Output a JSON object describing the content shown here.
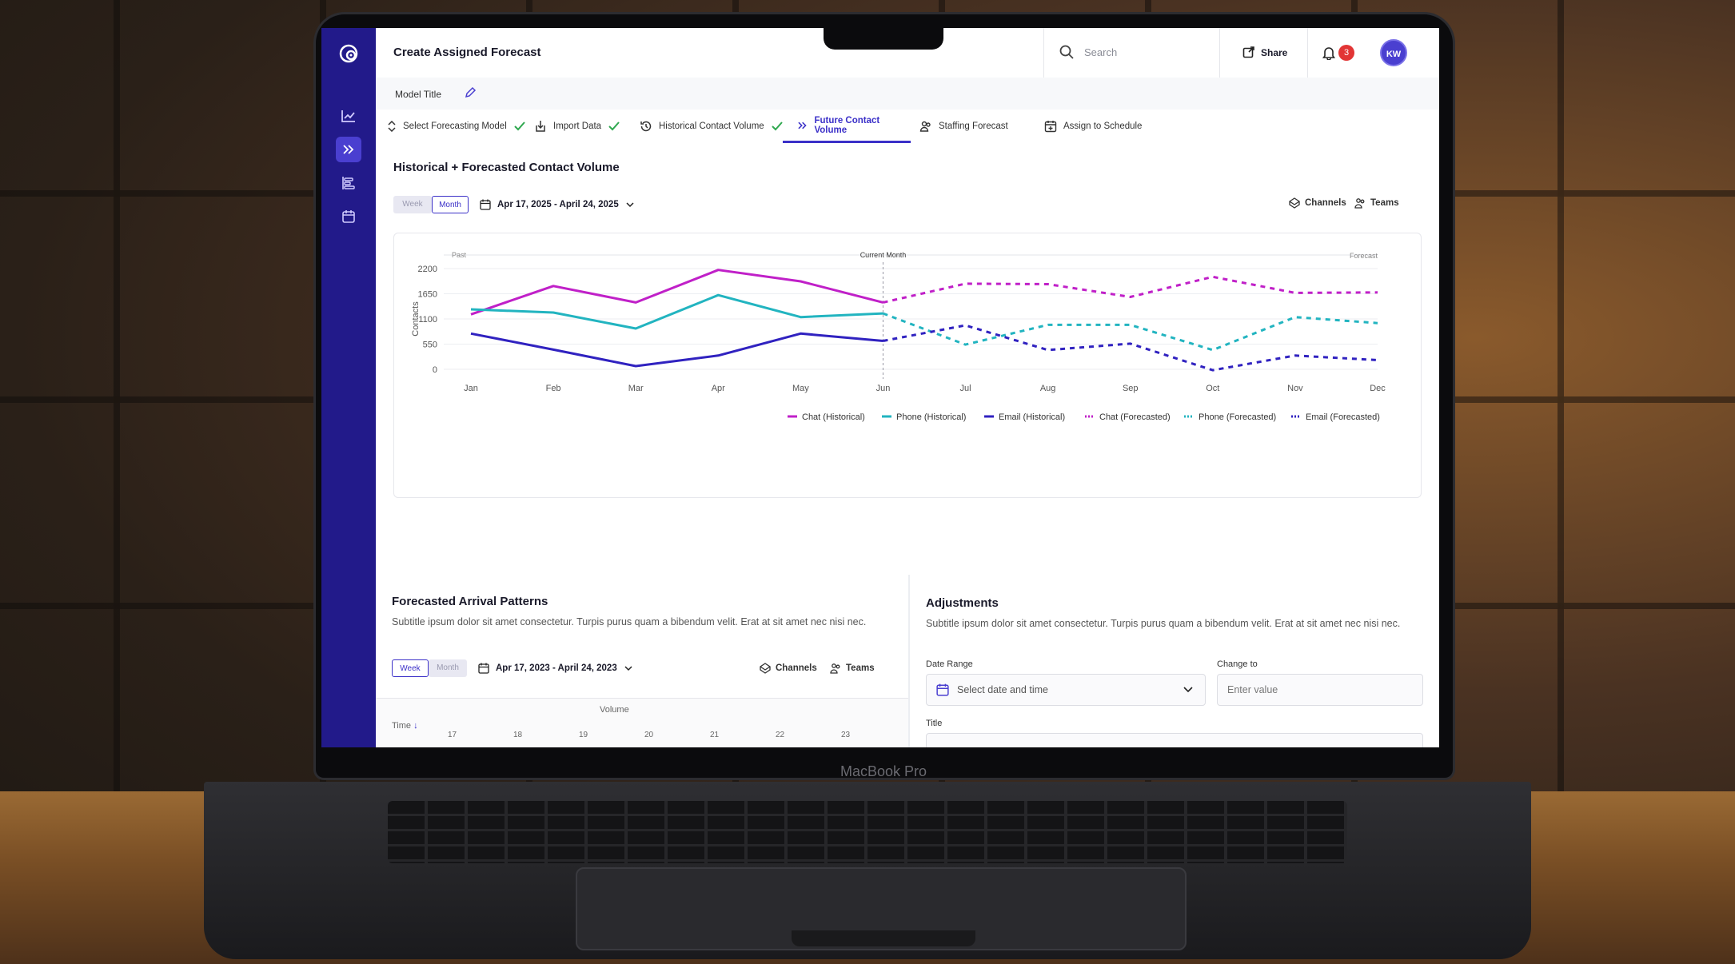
{
  "app": {
    "title": "Create Assigned Forecast",
    "search_placeholder": "Search",
    "share_label": "Share",
    "notification_count": "3",
    "avatar_initials": "KW",
    "model_title_label": "Model Title",
    "device_label": "MacBook Pro",
    "accent_color": "#3b30c8",
    "sidebar_color": "#221a8a"
  },
  "sidebar": {
    "items": [
      {
        "icon": "trend-chart-icon",
        "active": false
      },
      {
        "icon": "double-chevron-icon",
        "active": true
      },
      {
        "icon": "bars-icon",
        "active": false
      },
      {
        "icon": "calendar-icon",
        "active": false
      }
    ]
  },
  "steps": [
    {
      "label": "Select Forecasting Model",
      "icon": "sort-icon",
      "done": true
    },
    {
      "label": "Import Data",
      "icon": "import-icon",
      "done": true
    },
    {
      "label": "Historical Contact Volume",
      "icon": "history-icon",
      "done": true
    },
    {
      "label": "Future Contact Volume",
      "icon": "double-chevron-icon",
      "active": true
    },
    {
      "label": "Staffing Forecast",
      "icon": "people-icon",
      "done": false
    },
    {
      "label": "Assign to Schedule",
      "icon": "calendar-plus-icon",
      "done": false
    }
  ],
  "main": {
    "title": "Historical + Forecasted Contact Volume",
    "toggle": {
      "week": "Week",
      "month": "Month",
      "selected": "Month"
    },
    "date_range": "Apr 17, 2025 - April 24, 2025",
    "filters": {
      "channels": "Channels",
      "teams": "Teams"
    }
  },
  "chart_data": {
    "type": "line",
    "ylabel": "Contacts",
    "region_labels": {
      "past": "Past",
      "current": "Current Month",
      "forecast": "Forecast"
    },
    "x": [
      "Jan",
      "Feb",
      "Mar",
      "Apr",
      "May",
      "Jun",
      "Jul",
      "Aug",
      "Sep",
      "Oct",
      "Nov",
      "Dec"
    ],
    "yticks": [
      "2200",
      "1650",
      "1100",
      "550",
      "0"
    ],
    "ylim": [
      0,
      2200
    ],
    "current_month_index": 5,
    "grid": true,
    "legend_position": "bottom-right",
    "series": [
      {
        "name": "Chat (Historical)",
        "color": "#c020c8",
        "dash": false,
        "values": [
          1200,
          1820,
          1460,
          2170,
          1920,
          1460,
          null,
          null,
          null,
          null,
          null,
          null
        ]
      },
      {
        "name": "Phone (Historical)",
        "color": "#22b4c0",
        "dash": false,
        "values": [
          1310,
          1240,
          890,
          1620,
          1140,
          1220,
          null,
          null,
          null,
          null,
          null,
          null
        ]
      },
      {
        "name": "Email (Historical)",
        "color": "#3022c0",
        "dash": false,
        "values": [
          780,
          430,
          70,
          300,
          780,
          620,
          null,
          null,
          null,
          null,
          null,
          null
        ]
      },
      {
        "name": "Chat (Forecasted)",
        "color": "#c020c8",
        "dash": true,
        "values": [
          null,
          null,
          null,
          null,
          null,
          1460,
          1870,
          1860,
          1580,
          2020,
          1670,
          1680
        ]
      },
      {
        "name": "Phone (Forecasted)",
        "color": "#22b4c0",
        "dash": true,
        "values": [
          null,
          null,
          null,
          null,
          null,
          1220,
          540,
          970,
          970,
          420,
          1140,
          1010
        ]
      },
      {
        "name": "Email (Forecasted)",
        "color": "#3022c0",
        "dash": true,
        "values": [
          null,
          null,
          null,
          null,
          null,
          620,
          960,
          420,
          560,
          -20,
          300,
          200
        ]
      }
    ]
  },
  "arrival": {
    "title": "Forecasted Arrival Patterns",
    "subtitle": "Subtitle ipsum dolor sit amet consectetur. Turpis purus quam a bibendum velit. Erat at sit amet nec nisi nec.",
    "toggle": {
      "week": "Week",
      "month": "Month",
      "selected": "Week"
    },
    "date_range": "Apr 17, 2023 - April 24, 2023",
    "filters": {
      "channels": "Channels",
      "teams": "Teams"
    },
    "table": {
      "time_header": "Time",
      "volume_header": "Volume",
      "days": [
        "17",
        "18",
        "19",
        "20",
        "21",
        "22",
        "23"
      ]
    }
  },
  "adjustments": {
    "title": "Adjustments",
    "subtitle": "Subtitle ipsum dolor sit amet consectetur. Turpis purus quam a bibendum velit. Erat at sit amet nec nisi nec.",
    "date_range_label": "Date Range",
    "date_range_placeholder": "Select date and time",
    "change_to_label": "Change to",
    "change_to_placeholder": "Enter value",
    "title_label": "Title"
  }
}
